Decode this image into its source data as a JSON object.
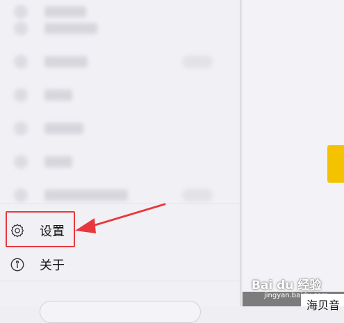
{
  "menu": {
    "settings_label": "设置",
    "about_label": "关于"
  },
  "watermark": {
    "logo_text": "Bai du 经验",
    "url_text": "jingyan.baidu.com"
  },
  "right_pane": {
    "partial_label": "海贝音"
  },
  "colors": {
    "highlight_box": "#e8383d",
    "arrow": "#e8383d",
    "accent_yellow": "#f5c200",
    "drawer_bg": "#f1f1f5"
  },
  "icons": {
    "settings": "gear-icon",
    "about": "info-circle-icon"
  }
}
